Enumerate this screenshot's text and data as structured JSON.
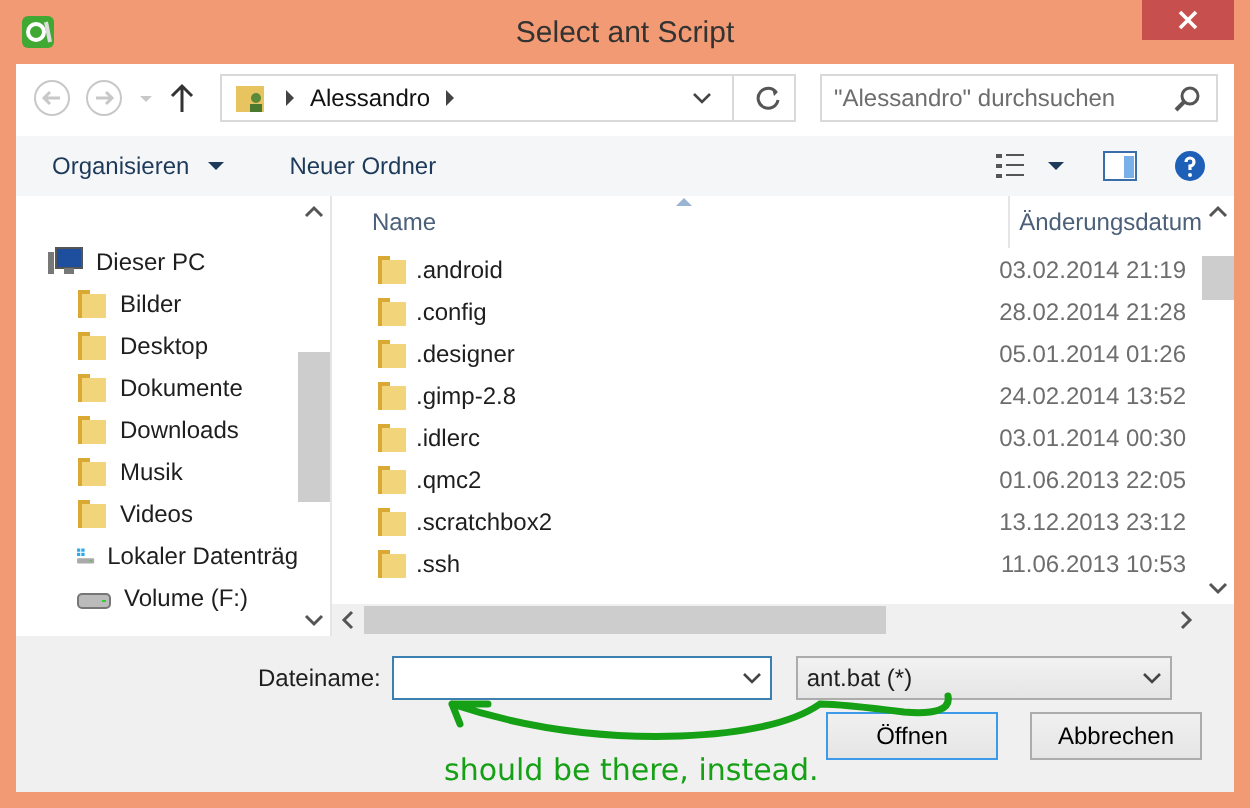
{
  "window": {
    "title": "Select ant Script"
  },
  "address": {
    "crumbs": [
      "Alessandro"
    ]
  },
  "search": {
    "placeholder": "\"Alessandro\" durchsuchen"
  },
  "toolbar": {
    "organize": "Organisieren",
    "new_folder": "Neuer Ordner"
  },
  "sidebar": {
    "items": [
      {
        "label": "Dieser PC",
        "kind": "pc",
        "children": [
          {
            "label": "Bilder",
            "kind": "folder"
          },
          {
            "label": "Desktop",
            "kind": "folder"
          },
          {
            "label": "Dokumente",
            "kind": "folder"
          },
          {
            "label": "Downloads",
            "kind": "folder"
          },
          {
            "label": "Musik",
            "kind": "folder"
          },
          {
            "label": "Videos",
            "kind": "folder"
          },
          {
            "label": "Lokaler Datenträg",
            "kind": "system-drive"
          },
          {
            "label": "Volume (F:)",
            "kind": "drive"
          }
        ]
      }
    ]
  },
  "table": {
    "columns": [
      "Name",
      "Änderungsdatum"
    ],
    "rows": [
      {
        "name": ".android",
        "date": "03.02.2014 21:19"
      },
      {
        "name": ".config",
        "date": "28.02.2014 21:28"
      },
      {
        "name": ".designer",
        "date": "05.01.2014 01:26"
      },
      {
        "name": ".gimp-2.8",
        "date": "24.02.2014 13:52"
      },
      {
        "name": ".idlerc",
        "date": "03.01.2014 00:30"
      },
      {
        "name": ".qmc2",
        "date": "01.06.2013 22:05"
      },
      {
        "name": ".scratchbox2",
        "date": "13.12.2013 23:12"
      },
      {
        "name": ".ssh",
        "date": "11.06.2013 10:53"
      }
    ]
  },
  "filename": {
    "label": "Dateiname:"
  },
  "filter": {
    "value": "ant.bat (*)"
  },
  "buttons": [
    "Öffnen",
    "Abbrechen"
  ],
  "annotation": {
    "text": "should be there, instead."
  }
}
